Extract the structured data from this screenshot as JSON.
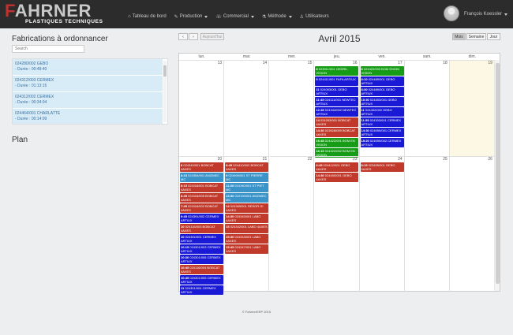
{
  "app": {
    "brand_main": "FAHRNER",
    "brand_sub": "PLASTIQUES TECHNIQUES"
  },
  "nav": {
    "items": [
      {
        "icon": "dashboard-icon",
        "glyph": "⌂",
        "label": "Tableau de bord",
        "dropdown": false
      },
      {
        "icon": "wrench-icon",
        "glyph": "✎",
        "label": "Production",
        "dropdown": true
      },
      {
        "icon": "phone-icon",
        "glyph": "☏",
        "label": "Commercial",
        "dropdown": true
      },
      {
        "icon": "flask-icon",
        "glyph": "⚗",
        "label": "Méthode",
        "dropdown": true
      },
      {
        "icon": "user-icon",
        "glyph": "♙",
        "label": "Utilisateurs",
        "dropdown": false
      }
    ],
    "user_name": "François Koessler"
  },
  "left": {
    "title": "Fabrications à ordonnancer",
    "search_placeholder": "Search",
    "items": [
      {
        "ref": "024280/002 GEBO",
        "duree": "- Durée : 00:48:40"
      },
      {
        "ref": "024312/003 CERMEX",
        "duree": "- Durée : 01:13:15"
      },
      {
        "ref": "024312/002 CERMEX",
        "duree": "- Durée : 00:34:04"
      },
      {
        "ref": "024464/001 CHARLATTE",
        "duree": "- Durée : 00:14:09"
      }
    ],
    "plan_title": "Plan"
  },
  "calendar": {
    "title": "Avril 2015",
    "prev": "‹",
    "next": "›",
    "today": "Aujourd'hui",
    "views": {
      "month": "Mois",
      "week": "Semaine",
      "day": "Jour"
    },
    "dow": [
      "lun.",
      "mar.",
      "mer.",
      "jeu.",
      "ven.",
      "sam.",
      "dim."
    ],
    "weeks": [
      {
        "days": [
          {
            "num": "13",
            "events": []
          },
          {
            "num": "14",
            "events": []
          },
          {
            "num": "15",
            "events": []
          },
          {
            "num": "16",
            "events": [
              {
                "time": "8",
                "text": "023911/001 OEDRIL VISION",
                "color": "green"
              },
              {
                "time": "9",
                "text": "024411/001 FAFA ARTIUX",
                "color": "blue"
              },
              {
                "time": "11",
                "text": "024093/001 GEBO ARTIUX",
                "color": "blue"
              },
              {
                "time": "11:45",
                "text": "024111/001 NEWTEC ARTIUX",
                "color": "blue"
              },
              {
                "time": "12:45",
                "text": "024344/002 NEWTEC ARTIUX",
                "color": "blue"
              },
              {
                "time": "14",
                "text": "024263/001 BOBCAT 4AXES",
                "color": "red"
              },
              {
                "time": "14:30",
                "text": "023928/009 BOBCAT 4AXES",
                "color": "red"
              },
              {
                "time": "16:45",
                "text": "024422/001 BOM EN VISION",
                "color": "green"
              },
              {
                "time": "16:15",
                "text": "024422/002 BOM EN VISION",
                "color": "green"
              }
            ]
          },
          {
            "num": "17",
            "events": [
              {
                "time": "8",
                "text": "024422/003 BOM ENGIN VISION",
                "color": "green"
              },
              {
                "time": "8:10",
                "text": "024489/001 GEBO ARTIUX",
                "color": "blue"
              },
              {
                "time": "8:30",
                "text": "024489/001 GEBO ARTIUX",
                "color": "blue"
              },
              {
                "time": "10:30",
                "text": "024403/001 GEBO ARTIUX",
                "color": "blue"
              },
              {
                "time": "11",
                "text": "024402/002 GEBO ARTIUX",
                "color": "blue"
              },
              {
                "time": "11:55",
                "text": "024303/001 CERMEX ARTIUX",
                "color": "blue"
              },
              {
                "time": "14:30",
                "text": "024099/001 CERMEX ARTIUX",
                "color": "blue"
              },
              {
                "time": "15:20",
                "text": "024099/002 CERMEX ARTIUX",
                "color": "blue"
              }
            ]
          },
          {
            "num": "18",
            "events": []
          },
          {
            "num": "19",
            "events": [],
            "today": true
          }
        ]
      },
      {
        "days": [
          {
            "num": "20",
            "events": [
              {
                "time": "8",
                "text": "024349/001 BOBCAT 4AXES",
                "color": "red"
              },
              {
                "time": "8:15",
                "text": "024354/001 ANZIMEC MC",
                "color": "teal"
              },
              {
                "time": "8:15",
                "text": "024116/001 BOBCAT 4AXES",
                "color": "red"
              },
              {
                "time": "8:45",
                "text": "024116/005 BOBCAT 4AXES",
                "color": "red"
              },
              {
                "time": "7:45",
                "text": "024116/002 BOBCAT 4AXES",
                "color": "red"
              },
              {
                "time": "9:45",
                "text": "024391/002 CERMEX ARTIUX",
                "color": "blue"
              },
              {
                "time": "10",
                "text": "024116/003 BOBCAT 4AXES",
                "color": "red"
              },
              {
                "time": "10",
                "text": "024301/001 CERMEX ARTIUX",
                "color": "blue"
              },
              {
                "time": "10:15",
                "text": "024301/003 CERMEX ARTIUX",
                "color": "blue"
              },
              {
                "time": "10:30",
                "text": "024301/006 CERMEX ARTIUX",
                "color": "blue"
              },
              {
                "time": "10:45",
                "text": "024116/004 BOBCAT 4AXES",
                "color": "red"
              },
              {
                "time": "10:45",
                "text": "024301/005 CERMEX ARTIUX",
                "color": "blue"
              },
              {
                "time": "11",
                "text": "024301/004 CERMEX ARTIUX",
                "color": "blue"
              }
            ]
          },
          {
            "num": "21",
            "events": [
              {
                "time": "8:45",
                "text": "024410/002 BOBCAT 4AXES",
                "color": "red"
              },
              {
                "time": "9",
                "text": "024490/001 ST PIERRE MC",
                "color": "teal"
              },
              {
                "time": "11:30",
                "text": "024190/001 ST PIET MC",
                "color": "teal"
              },
              {
                "time": "13:30",
                "text": "024190/001 ANZIMEC MC",
                "color": "teal"
              },
              {
                "time": "14",
                "text": "024365/001 RESOR GI 4AXES",
                "color": "red"
              },
              {
                "time": "14:30",
                "text": "024340/001 LABO 4AXES",
                "color": "red"
              },
              {
                "time": "15",
                "text": "024342/001 LABO 4AXES",
                "color": "red"
              },
              {
                "time": "15:30",
                "text": "024343/001 LABO 4AXES",
                "color": "red"
              },
              {
                "time": "15:45",
                "text": "024347/001 LABO 4AXES",
                "color": "red"
              }
            ]
          },
          {
            "num": "22",
            "events": []
          },
          {
            "num": "23",
            "events": [
              {
                "time": "8:45",
                "text": "024412/001 GEBO 4AXES",
                "color": "red"
              },
              {
                "time": "14:30",
                "text": "024490/001 GEBO 4AXES",
                "color": "red"
              }
            ]
          },
          {
            "num": "24",
            "events": [
              {
                "time": "8:15",
                "text": "023405/001 GEBO 4AXES",
                "color": "red"
              }
            ]
          },
          {
            "num": "25",
            "events": []
          },
          {
            "num": "26",
            "events": []
          }
        ]
      }
    ],
    "colors": {
      "red": "#c0392b",
      "blue": "#1a1ad6",
      "green": "#169c16",
      "teal": "#3a93c9",
      "today": "#fcf8e3"
    }
  },
  "footer": {
    "text": "© FahrnerERP 2015"
  }
}
